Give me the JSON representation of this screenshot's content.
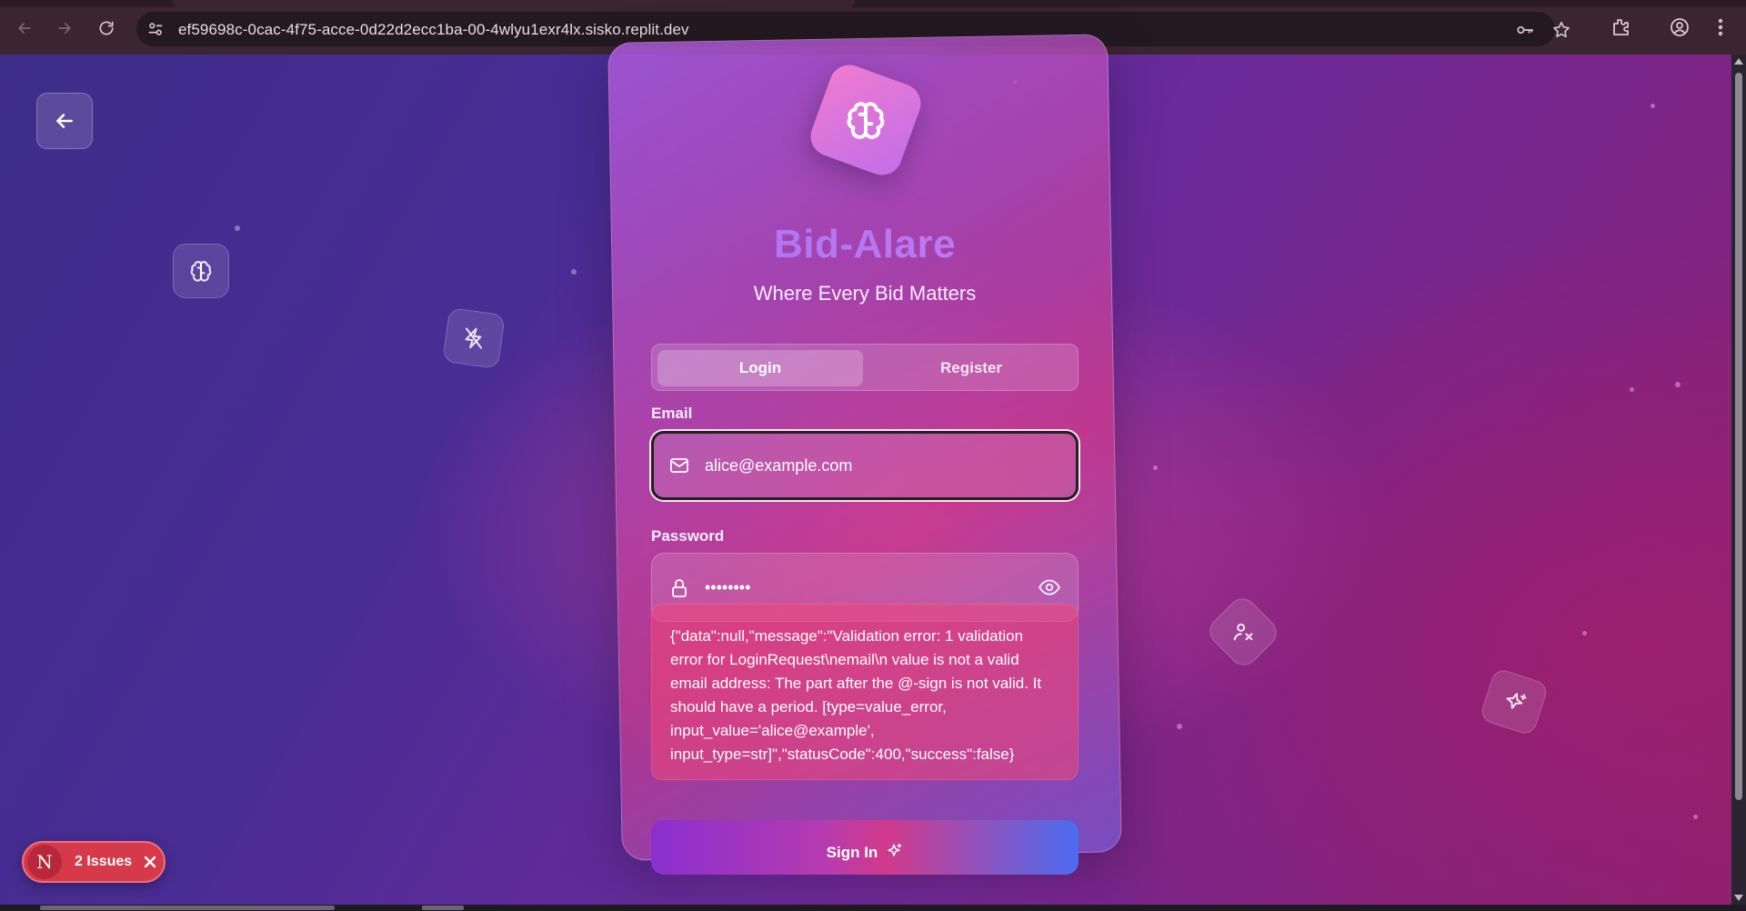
{
  "browser": {
    "url": "ef59698c-0cac-4f75-acce-0d22d2ecc1ba-00-4wlyu1exr4lx.sisko.replit.dev"
  },
  "app": {
    "brand_name": "Bid-Alare",
    "tagline": "Where Every Bid Matters",
    "tabs": [
      {
        "label": "Login",
        "active": true
      },
      {
        "label": "Register",
        "active": false
      }
    ],
    "email": {
      "label": "Email",
      "value": "alice@example.com"
    },
    "password": {
      "label": "Password",
      "value": "••••••••"
    },
    "error_message": "{\"data\":null,\"message\":\"Validation error: 1 validation error for LoginRequest\\nemail\\n value is not a valid email address: The part after the @-sign is not valid. It should have a period. [type=value_error, input_value='alice@example', input_type=str]\",\"statusCode\":400,\"success\":false}",
    "submit_label": "Sign In"
  },
  "issues_badge": {
    "logo": "N",
    "label": "2 Issues"
  },
  "colors": {
    "brand_gradient_start": "#a873f3",
    "brand_gradient_end": "#c57bf0",
    "error_background": "#f04678",
    "issues_badge": "#d63a4a"
  }
}
